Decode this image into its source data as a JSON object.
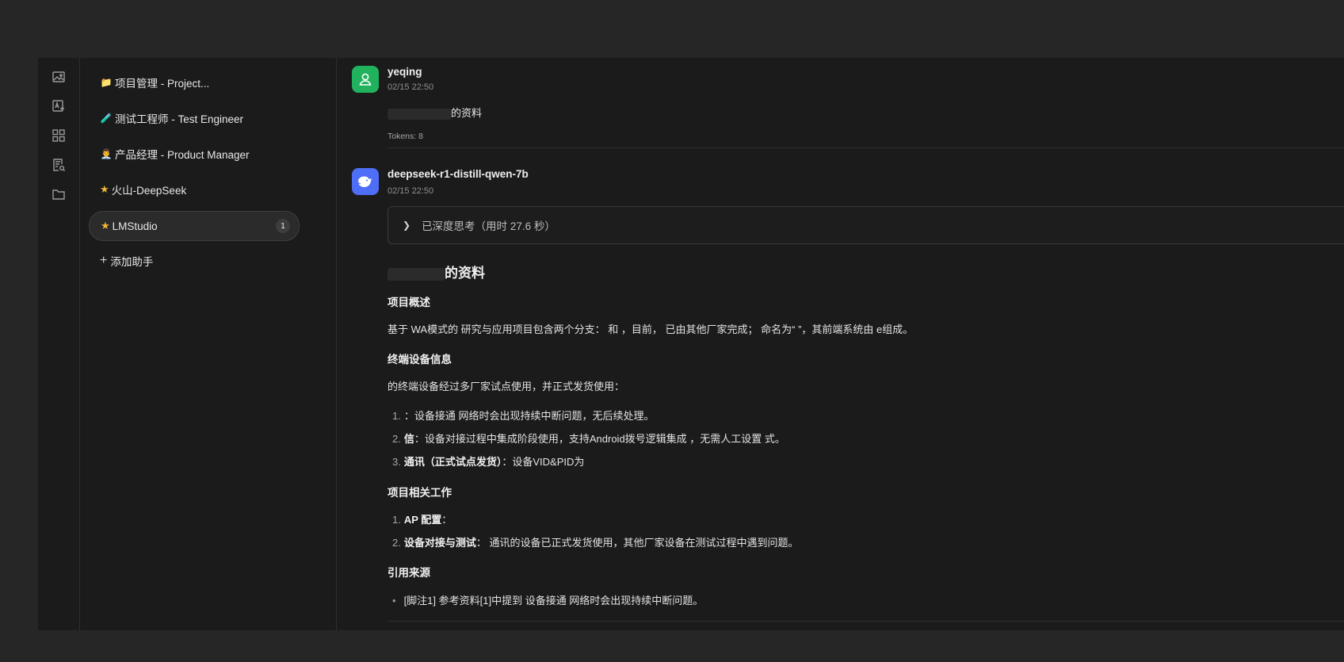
{
  "rail": {
    "icons": [
      "image-icon",
      "image-edit-icon",
      "apps-grid-icon",
      "document-search-icon",
      "folder-icon"
    ]
  },
  "assistants": {
    "items": [
      {
        "emoji": "📁",
        "label": "项目管理 - Project..."
      },
      {
        "emoji": "🧪",
        "label": "测试工程师 - Test Engineer"
      },
      {
        "emoji": "👨‍💼",
        "label": "产品经理 - Product Manager"
      },
      {
        "emoji": "★",
        "label": "火山-DeepSeek"
      },
      {
        "emoji": "★",
        "label": "LMStudio",
        "badge": "1"
      }
    ],
    "add_label": "添加助手",
    "star_color": "#f2b734"
  },
  "chat": {
    "user_msg": {
      "name": "yeqing",
      "time": "02/15 22:50",
      "text": "的资料",
      "tokens": "Tokens: 8",
      "avatar_color": "#21b25d"
    },
    "bot_msg": {
      "name": "deepseek-r1-distill-qwen-7b",
      "time": "02/15 22:50",
      "avatar_color": "#4f6ef7",
      "thinking": "已深度思考（用时 27.6 秒）",
      "title": "的资料",
      "sections": [
        {
          "heading": "项目概述",
          "para": "基于 WA模式的 研究与应用项目包含两个分支： 和 ，目前， 已由其他厂家完成； 命名为“ ”，其前端系统由 e组成。"
        },
        {
          "heading": "终端设备信息",
          "para": "的终端设备经过多厂家试点使用，并正式发货使用：",
          "items": [
            {
              "num": "1.",
              "bold": "",
              "text": "：设备接通 网络时会出现持续中断问题，无后续处理。"
            },
            {
              "num": "2.",
              "bold": "信",
              "text": "：设备对接过程中集成阶段使用，支持Android拨号逻辑集成 ，无需人工设置 式。"
            },
            {
              "num": "3.",
              "bold": "通讯（正式试点发货）",
              "text": "：设备VID&PID为"
            }
          ]
        },
        {
          "heading": "项目相关工作",
          "items": [
            {
              "num": "1.",
              "bold": "AP 配置",
              "text": "："
            },
            {
              "num": "2.",
              "bold": "设备对接与测试",
              "text": "： 通讯的设备已正式发货使用，其他厂家设备在测试过程中遇到问题。"
            }
          ]
        },
        {
          "heading": "引用来源",
          "bullets": [
            "[脚注1] 参考资料[1]中提到 设备接通 网络时会出现持续中断问题。"
          ]
        }
      ]
    }
  }
}
